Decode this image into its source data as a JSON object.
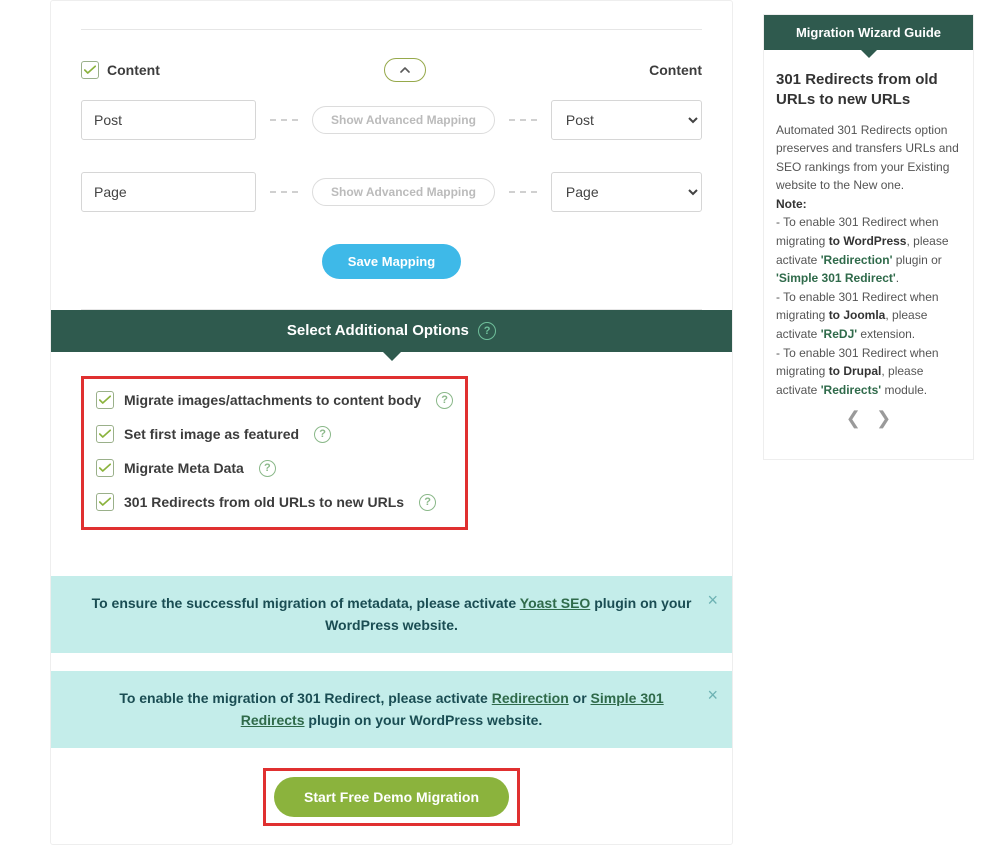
{
  "mapping": {
    "header_left": "Content",
    "header_right": "Content",
    "rows": [
      {
        "source": "Post",
        "advanced_label": "Show Advanced Mapping",
        "target": "Post"
      },
      {
        "source": "Page",
        "advanced_label": "Show Advanced Mapping",
        "target": "Page"
      }
    ],
    "save_button": "Save Mapping"
  },
  "options": {
    "header": "Select Additional Options",
    "items": [
      {
        "label": "Migrate images/attachments to content body"
      },
      {
        "label": "Set first image as featured"
      },
      {
        "label": "Migrate Meta Data"
      },
      {
        "label": "301 Redirects from old URLs to new URLs"
      }
    ]
  },
  "alerts": {
    "a1": {
      "pre": "To ensure the successful migration of metadata, please activate ",
      "link": "Yoast SEO",
      "post": " plugin on your WordPress website."
    },
    "a2": {
      "pre": "To enable the migration of 301 Redirect, please activate ",
      "link1": "Redirection",
      "mid": " or ",
      "link2": "Simple 301 Redirects",
      "post": " plugin on your WordPress website."
    }
  },
  "demo": {
    "button": "Start Free Demo Migration"
  },
  "sidebar": {
    "header": "Migration Wizard Guide",
    "title": "301 Redirects from old URLs to new URLs",
    "intro": "Automated 301 Redirects option preserves and transfers URLs and SEO rankings from your Existing website to the New one.",
    "note_label": "Note:",
    "b1a": "- To enable 301 Redirect when migrating ",
    "b1b": "to WordPress",
    "b1c": ", please activate ",
    "b1d": "'Redirection'",
    "b1e": " plugin or ",
    "b1f": "'Simple 301 Redirect'",
    "b1g": ".",
    "b2a": "- To enable 301 Redirect when migrating ",
    "b2b": "to Joomla",
    "b2c": ", please activate ",
    "b2d": "'ReDJ'",
    "b2e": " extension.",
    "b3a": "- To enable 301 Redirect when migrating ",
    "b3b": "to Drupal",
    "b3c": ", please activate ",
    "b3d": "'Redirects'",
    "b3e": " module."
  },
  "help": "?"
}
